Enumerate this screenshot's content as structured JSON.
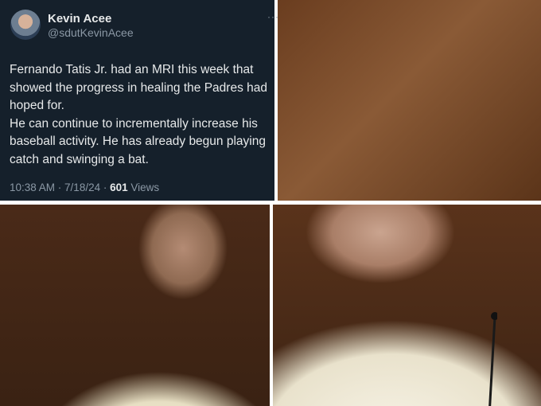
{
  "tweet": {
    "author_name": "Kevin Acee",
    "author_handle": "@sdutKevinAcee",
    "more_icon": "ellipsis-icon",
    "text_line1": "Fernando Tatis Jr. had an MRI this week that showed the progress in healing the Padres had hoped for.",
    "text_line2": "He can continue to incrementally increase his baseball activity. He has already begun playing catch and swinging a bat.",
    "time": "10:38 AM",
    "sep1": " · ",
    "date": "7/18/24",
    "sep2": " · ",
    "views_count": "601",
    "views_label": " Views"
  },
  "colors": {
    "card_bg": "#15202b",
    "text_primary": "#e7e9ea",
    "text_secondary": "#8b98a5"
  }
}
